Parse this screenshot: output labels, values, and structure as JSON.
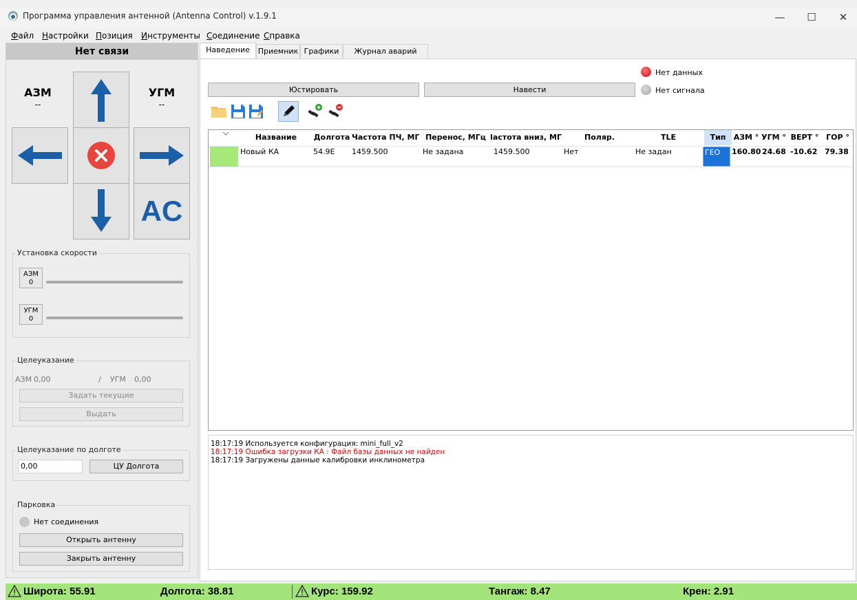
{
  "window": {
    "title": "Программа управления антенной (Antenna Control) v.1.9.1",
    "min": "—",
    "max": "☐",
    "close": "✕"
  },
  "menu": [
    "Файл",
    "Настройки",
    "Позиция",
    "Инструменты",
    "Соединение",
    "Справка"
  ],
  "left": {
    "connection_status": "Нет связи",
    "azm_label": "АЗМ",
    "azm_value": "--",
    "ugm_label": "УГМ",
    "ugm_value": "--",
    "ac_label": "AC",
    "speed": {
      "title": "Установка скорости",
      "azm_label": "АЗМ",
      "azm_value": "0",
      "ugm_label": "УГМ",
      "ugm_value": "0"
    },
    "target": {
      "title": "Целеуказание",
      "azm_label": "АЗМ",
      "azm_value": "0,00",
      "separator": "/",
      "ugm_label": "УГМ",
      "ugm_value": "0,00",
      "set_current": "Задать текущие",
      "issue": "Выдать"
    },
    "longitude_target": {
      "title": "Целеуказание по долготе",
      "value": "0,00",
      "button": "ЦУ Долгота"
    },
    "parking": {
      "title": "Парковка",
      "status": "Нет соединения",
      "open": "Открыть антенну",
      "close": "Закрыть антенну"
    }
  },
  "tabs": [
    "Наведение",
    "Приемник",
    "Графики",
    "Журнал аварий"
  ],
  "active_tab": 0,
  "main": {
    "adjust_button": "Юстировать",
    "point_button": "Навести",
    "status_data": "Нет данных",
    "status_signal": "Нет сигнала",
    "colors": {
      "led_red": "#e02020",
      "led_gray": "#b4b4b4",
      "row_green": "#a6e87a",
      "selected": "#1a73d9"
    }
  },
  "table": {
    "headers": [
      "Название",
      "Долгота",
      "Частота ПЧ, МГц",
      "Перенос, МГц",
      "Частота вниз, МГц",
      "Поляр.",
      "TLE",
      "Тип",
      "АЗМ °",
      "УГМ °",
      "ВЕРТ °",
      "ГОР °"
    ],
    "header_display_freq_down": "Частота вниз, МГц",
    "rows": [
      {
        "name": "Новый КА",
        "longitude": "54.9E",
        "freq_if": "1459.500",
        "shift": "Не задана",
        "freq_down": "1459.500",
        "polar": "Нет",
        "tle": "Не задан",
        "type": "ГЕО",
        "azm": "160.80",
        "ugm": "24.68",
        "vert": "-10.62",
        "hor": "79.38"
      }
    ]
  },
  "log": [
    {
      "text": "18:17:19 Используется конфигурация: mini_full_v2",
      "color": "#000000"
    },
    {
      "text": "18:17:19 Ошибка загрузки КА : Файл базы данных не найден",
      "color": "#e00000"
    },
    {
      "text": "18:17:19 Загружены данные калибровки инклинометра",
      "color": "#000000"
    }
  ],
  "statusbar": {
    "lat": "Широта: 55.91",
    "lon": "Долгота: 38.81",
    "course": "Курс: 159.92",
    "pitch": "Тангаж: 8.47",
    "roll": "Крен: 2.91"
  }
}
